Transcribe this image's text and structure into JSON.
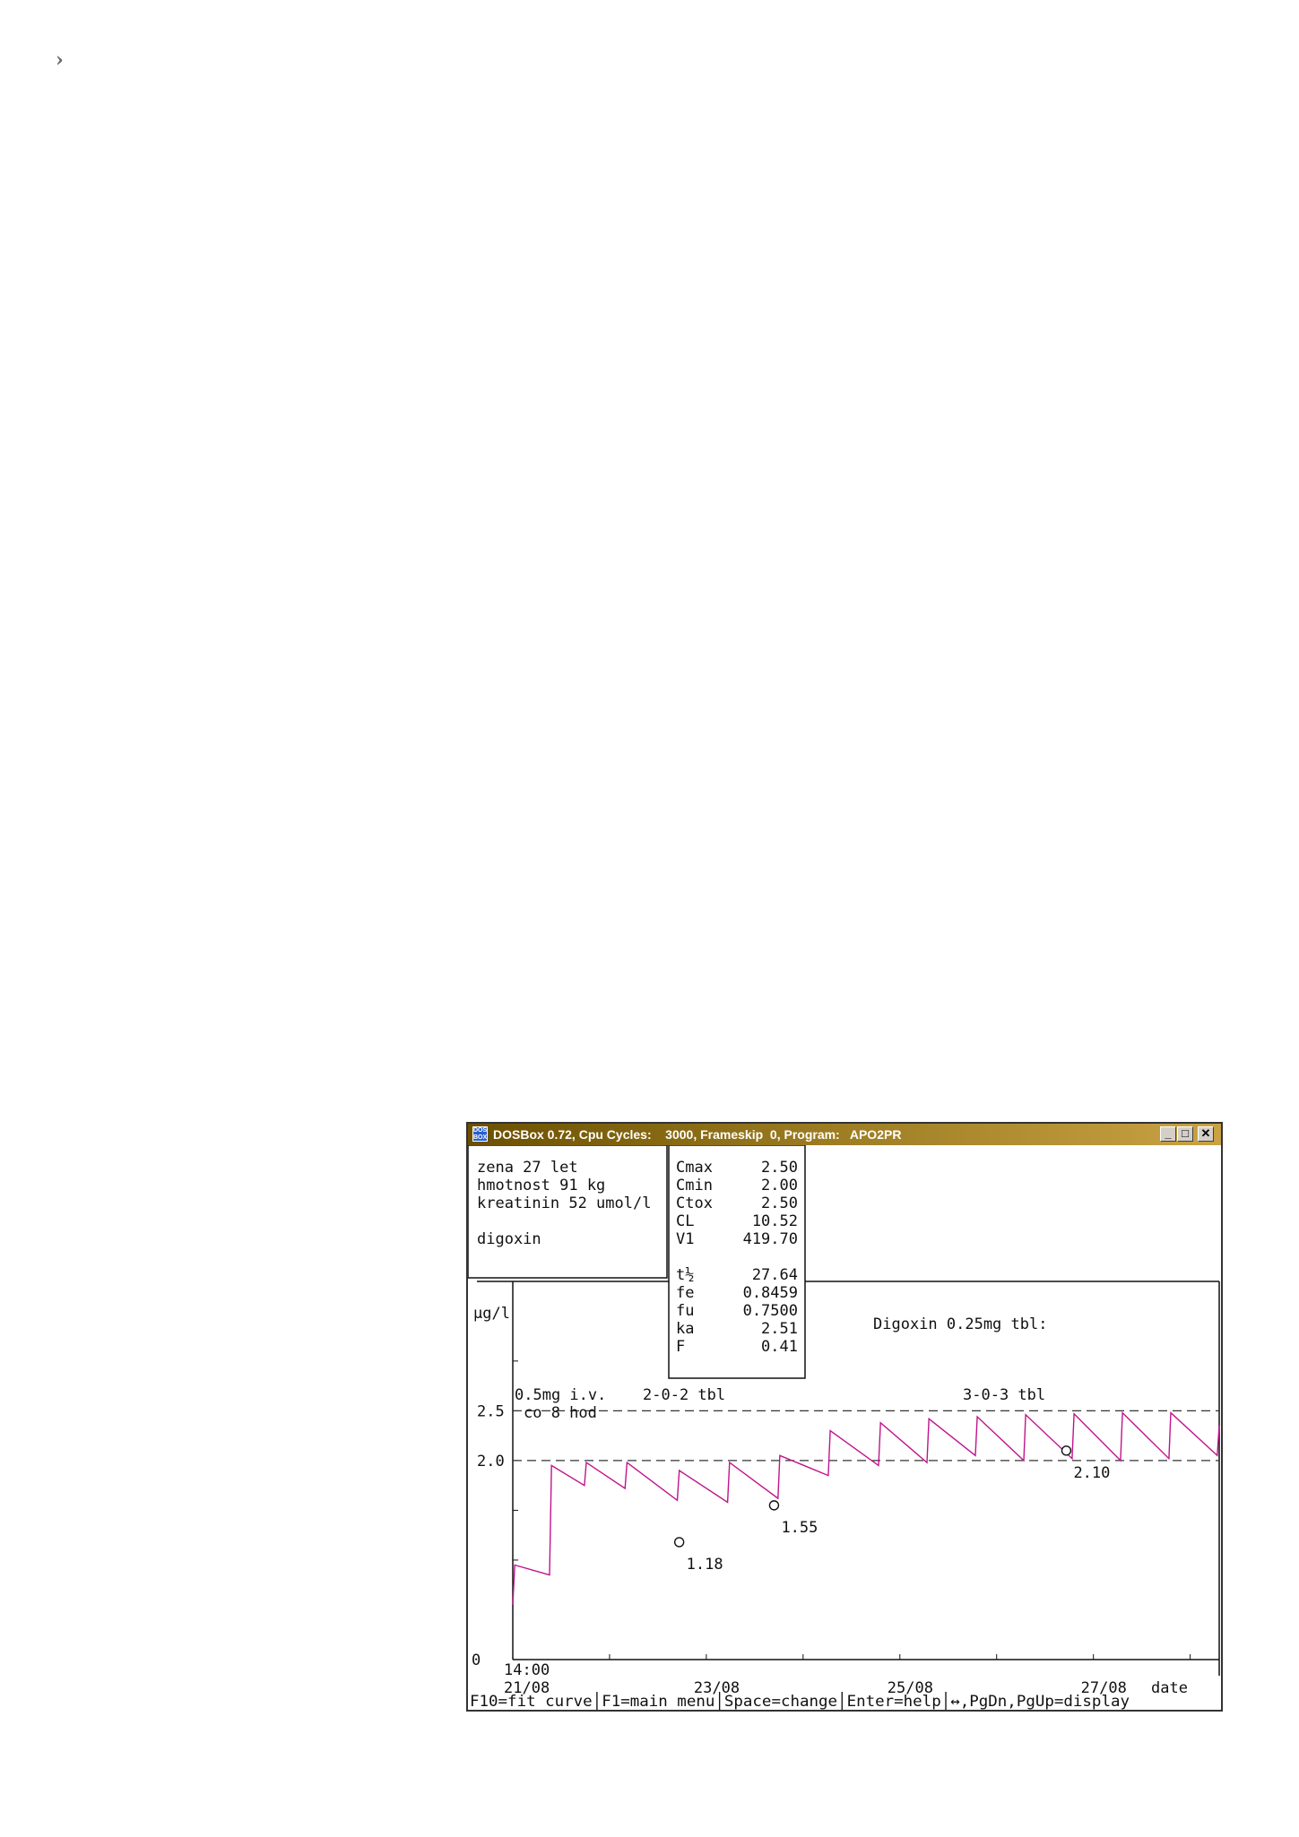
{
  "page": {
    "corner_mark": "›"
  },
  "window": {
    "title": "DOSBox 0.72, Cpu Cycles:    3000, Frameskip  0, Program:   APO2PR",
    "icon_label": "DOS BOX",
    "controls": {
      "minimize": "_",
      "maximize": "□",
      "close": "✕"
    }
  },
  "patient_panel": {
    "lines": [
      "zena 27 let",
      "hmotnost 91 kg",
      "kreatinin 52 umol/l",
      "",
      "digoxin"
    ]
  },
  "params_panel": {
    "rows": [
      {
        "name": "Cmax",
        "value": "2.50"
      },
      {
        "name": "Cmin",
        "value": "2.00"
      },
      {
        "name": "Ctox",
        "value": "2.50"
      },
      {
        "name": "CL",
        "value": "10.52"
      },
      {
        "name": "V1",
        "value": "419.70"
      },
      {
        "name": "",
        "value": ""
      },
      {
        "name": "t½",
        "value": "27.64"
      },
      {
        "name": "fe",
        "value": "0.8459"
      },
      {
        "name": "fu",
        "value": "0.7500"
      },
      {
        "name": "ka",
        "value": "2.51"
      },
      {
        "name": "F",
        "value": "0.41"
      }
    ]
  },
  "status_bar": "F10=fit curve│F1=main menu│Space=change│Enter=help│↔,PgDn,PgUp=display",
  "chart_data": {
    "type": "line",
    "ylabel": "µg/l",
    "xlabel": "date",
    "y_ticks": [
      {
        "value": 0,
        "label": "0"
      },
      {
        "value": 2.0,
        "label": "2.0"
      },
      {
        "value": 2.5,
        "label": "2.5"
      }
    ],
    "x_start_label": "14:00",
    "x_ticks": [
      {
        "x": 0.0,
        "label": "21/08"
      },
      {
        "x": 2.0,
        "label": "23/08"
      },
      {
        "x": 4.0,
        "label": "25/08"
      },
      {
        "x": 6.0,
        "label": "27/08"
      }
    ],
    "ylim": [
      0,
      3.8
    ],
    "xlim": [
      0,
      7.3
    ],
    "reference_lines": [
      {
        "name": "Cmax",
        "value": 2.5,
        "style": "dashed"
      },
      {
        "name": "Cmin",
        "value": 2.0,
        "style": "dashed"
      }
    ],
    "annotations": [
      {
        "text": "Digoxin 0.25mg tbl:"
      },
      {
        "text": "0.5mg i.v."
      },
      {
        "text": "co 8 hod"
      },
      {
        "text": "2-0-2 tbl"
      },
      {
        "text": "3-0-3 tbl"
      }
    ],
    "series": [
      {
        "color": "#c0148c",
        "x": [
          0.0,
          0.02,
          0.38,
          0.4,
          0.74,
          0.76,
          1.16,
          1.18,
          1.7,
          1.72,
          2.22,
          2.24,
          2.74,
          2.76,
          3.26,
          3.28,
          3.78,
          3.8,
          4.28,
          4.3,
          4.78,
          4.8,
          5.28,
          5.3,
          5.78,
          5.8,
          6.28,
          6.3,
          6.78,
          6.8,
          7.28,
          7.3
        ],
        "y": [
          0.55,
          0.95,
          0.85,
          1.95,
          1.75,
          1.98,
          1.72,
          1.98,
          1.6,
          1.9,
          1.58,
          1.98,
          1.62,
          2.05,
          1.85,
          2.3,
          1.95,
          2.38,
          1.98,
          2.42,
          2.05,
          2.44,
          2.0,
          2.46,
          2.02,
          2.47,
          2.0,
          2.48,
          2.02,
          2.48,
          2.05,
          2.35
        ]
      }
    ],
    "measurements": [
      {
        "x": 1.72,
        "y": 1.18,
        "label": "1.18"
      },
      {
        "x": 2.7,
        "y": 1.55,
        "label": "1.55"
      },
      {
        "x": 5.72,
        "y": 2.1,
        "label": "2.10"
      }
    ]
  }
}
